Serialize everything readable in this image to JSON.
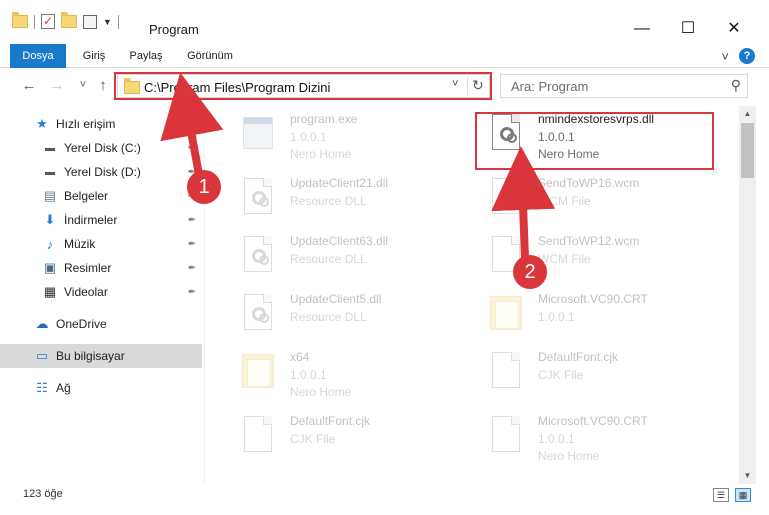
{
  "window": {
    "title": "Program",
    "minimize": "—",
    "maximize": "☐",
    "close": "✕"
  },
  "ribbon": {
    "tabs": [
      "Dosya",
      "Giriş",
      "Paylaş",
      "Görünüm"
    ],
    "expand": "˅",
    "help": "?"
  },
  "nav": {
    "back": "←",
    "forward": "→",
    "recent": "˅",
    "up": "↑",
    "address": "C:\\Program Files\\Program Dizini",
    "address_dropdown": "˅",
    "refresh": "↻",
    "search_placeholder": "Ara: Program",
    "search_icon": "search-icon"
  },
  "sidebar": {
    "items": [
      {
        "label": "Hızlı erişim",
        "icon": "star-icon",
        "glyph": "★",
        "color": "#2a7fd4",
        "pinned": false
      },
      {
        "label": "Yerel Disk (C:)",
        "icon": "drive-icon",
        "glyph": "▬",
        "color": "#555555",
        "pinned": true
      },
      {
        "label": "Yerel Disk (D:)",
        "icon": "drive-icon",
        "glyph": "▬",
        "color": "#555555",
        "pinned": true
      },
      {
        "label": "Belgeler",
        "icon": "documents-icon",
        "glyph": "▤",
        "color": "#6b7b8c",
        "pinned": true
      },
      {
        "label": "İndirmeler",
        "icon": "download-icon",
        "glyph": "⬇",
        "color": "#2a7fd4",
        "pinned": true
      },
      {
        "label": "Müzik",
        "icon": "music-icon",
        "glyph": "♪",
        "color": "#2a7fd4",
        "pinned": true
      },
      {
        "label": "Resimler",
        "icon": "pictures-icon",
        "glyph": "▣",
        "color": "#4a6b8a",
        "pinned": true
      },
      {
        "label": "Videolar",
        "icon": "video-icon",
        "glyph": "▦",
        "color": "#333333",
        "pinned": true
      },
      {
        "label": "OneDrive",
        "icon": "cloud-icon",
        "glyph": "☁",
        "color": "#1f6fc5",
        "pinned": false
      },
      {
        "label": "Bu bilgisayar",
        "icon": "computer-icon",
        "glyph": "▭",
        "color": "#2a7fd4",
        "pinned": false
      },
      {
        "label": "Ağ",
        "icon": "network-icon",
        "glyph": "☷",
        "color": "#2a7fd4",
        "pinned": false
      }
    ],
    "pin_glyph": "✒"
  },
  "files": [
    {
      "name": "program.exe",
      "line1": "1.0.0.1",
      "line2": "Nero Home",
      "kind": "exe",
      "highlighted": false
    },
    {
      "name": "nmindexstoresvrps.dll",
      "line1": "1.0.0.1",
      "line2": "Nero Home",
      "kind": "dll",
      "highlighted": true
    },
    {
      "name": "UpdateClient21.dll",
      "line1": "Resource DLL",
      "line2": "",
      "kind": "dll",
      "highlighted": false
    },
    {
      "name": "SendToWP16.wcm",
      "line1": "WCM File",
      "line2": "",
      "kind": "doc",
      "highlighted": false
    },
    {
      "name": "UpdateClient63.dll",
      "line1": "Resource DLL",
      "line2": "",
      "kind": "dll",
      "highlighted": false
    },
    {
      "name": "SendToWP12.wcm",
      "line1": "WCM File",
      "line2": "",
      "kind": "doc",
      "highlighted": false
    },
    {
      "name": "UpdateClient5.dll",
      "line1": "Resource DLL",
      "line2": "",
      "kind": "dll",
      "highlighted": false
    },
    {
      "name": "Microsoft.VC90.CRT",
      "line1": "1.0.0.1",
      "line2": "",
      "kind": "folder",
      "highlighted": false
    },
    {
      "name": "x64",
      "line1": "1.0.0.1",
      "line2": "Nero Home",
      "kind": "folder",
      "highlighted": false
    },
    {
      "name": "DefaultFont.cjk",
      "line1": "CJK File",
      "line2": "",
      "kind": "doc",
      "highlighted": false
    },
    {
      "name": "DefaultFont.cjk",
      "line1": "CJK File",
      "line2": "",
      "kind": "doc",
      "highlighted": false
    },
    {
      "name": "Microsoft.VC90.CRT",
      "line1": "1.0.0.1",
      "line2": "Nero Home",
      "kind": "doc",
      "highlighted": false
    }
  ],
  "callouts": [
    "1",
    "2"
  ],
  "status": {
    "count": "123 öğe",
    "details_view": "☰",
    "tiles_view": "▦"
  },
  "colors": {
    "accent": "#1979ca",
    "highlight_red": "#d9353b",
    "selected_nav": "#d9d9d9"
  }
}
